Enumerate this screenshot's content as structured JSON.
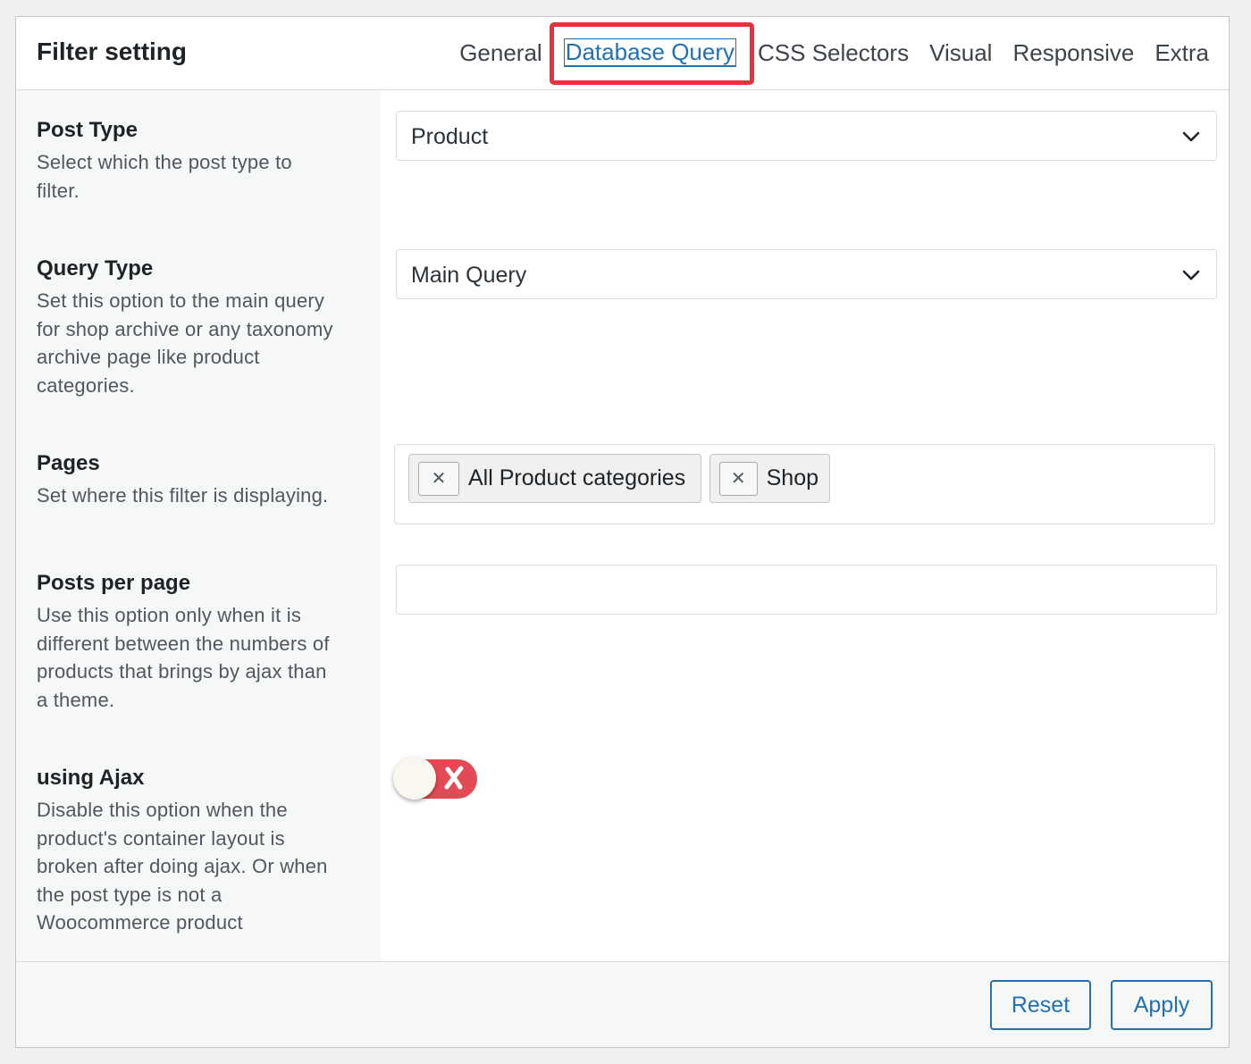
{
  "panel": {
    "title": "Filter setting"
  },
  "tabs": [
    {
      "label": "General",
      "active": false
    },
    {
      "label": "Database Query",
      "active": true
    },
    {
      "label": "CSS Selectors",
      "active": false
    },
    {
      "label": "Visual",
      "active": false
    },
    {
      "label": "Responsive",
      "active": false
    },
    {
      "label": "Extra",
      "active": false
    }
  ],
  "fields": {
    "post_type": {
      "title": "Post Type",
      "desc_lines": [
        "Select which the post type to",
        "filter."
      ],
      "value": "Product"
    },
    "query_type": {
      "title": "Query Type",
      "desc_lines": [
        "Set this option to the main query",
        "for shop archive or any taxonomy",
        "archive page like product",
        "categories."
      ],
      "value": "Main Query"
    },
    "pages": {
      "title": "Pages",
      "desc_lines": [
        "Set where this filter is displaying."
      ],
      "chips": [
        "All Product categories",
        "Shop"
      ]
    },
    "posts_per_page": {
      "title": "Posts per page",
      "desc_lines": [
        "Use this option only when it is",
        "different between the numbers of",
        "products that brings by ajax than",
        "a theme."
      ],
      "value": ""
    },
    "using_ajax": {
      "title": "using Ajax",
      "desc_lines": [
        "Disable this option when the",
        "product's container layout is",
        "broken after doing ajax. Or when",
        "the post type is not a",
        "Woocommerce product"
      ],
      "enabled": false
    }
  },
  "footer": {
    "reset_label": "Reset",
    "apply_label": "Apply"
  },
  "colors": {
    "accent": "#2271b1",
    "highlight": "#e8303f",
    "toggle_off": "#e34a55"
  },
  "icons": {
    "select_arrow": "chevron-down-icon",
    "chip_remove": "close-icon",
    "toggle_off": "x-mark-icon"
  }
}
